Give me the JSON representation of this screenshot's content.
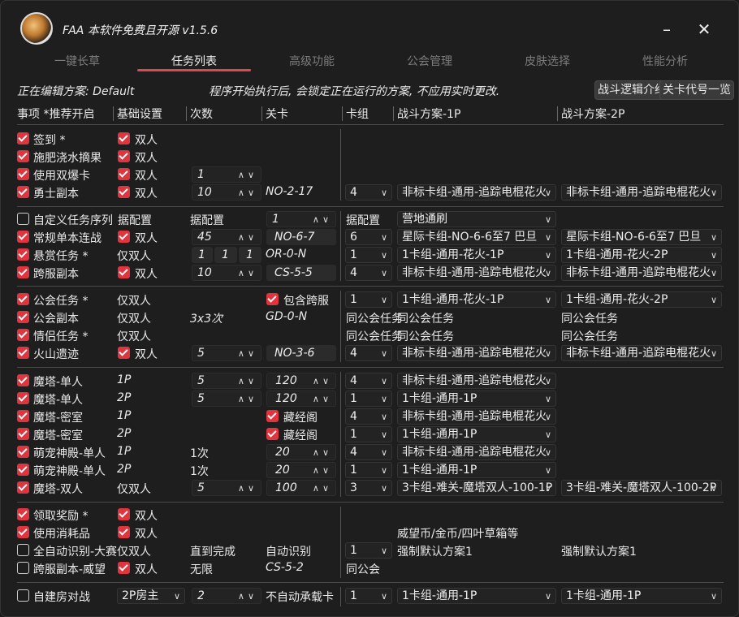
{
  "app": {
    "title": "FAA 本软件免费且开源 v1.5.6",
    "minimize": "–",
    "close": "✕"
  },
  "tabs": [
    {
      "label": "一键长草",
      "active": false
    },
    {
      "label": "任务列表",
      "active": true
    },
    {
      "label": "高级功能",
      "active": false
    },
    {
      "label": "公会管理",
      "active": false
    },
    {
      "label": "皮肤选择",
      "active": false
    },
    {
      "label": "性能分析",
      "active": false
    }
  ],
  "info": {
    "editing": "正在编辑方案: Default",
    "notice": "程序开始执行后, 会锁定正在运行的方案, 不应用实时更改."
  },
  "buttons": {
    "battle_logic": "战斗逻辑介绍",
    "level_codes": "关卡代号一览"
  },
  "headers": {
    "item": "事项 *推荐开启",
    "basic": "基础设置",
    "count": "次数",
    "level": "关卡",
    "deck": "卡组",
    "plan1": "战斗方案-1P",
    "plan2": "战斗方案-2P"
  },
  "colors": {
    "accent": "#e0343f",
    "background": "#1e1e1e"
  },
  "group1": {
    "sign": {
      "label": "签到 *",
      "checked": true,
      "double": "双人",
      "double_checked": true
    },
    "fert": {
      "label": "施肥浇水摘果",
      "checked": true,
      "double": "双人",
      "double_checked": true
    },
    "bomb": {
      "label": "使用双爆卡",
      "checked": true,
      "double": "双人",
      "double_checked": true,
      "count": "1"
    },
    "hero": {
      "label": "勇士副本",
      "checked": true,
      "double": "双人",
      "double_checked": true,
      "count": "10",
      "level": "NO-2-17",
      "deck": "4",
      "plan1": "非标卡组-通用-追踪电棍花火",
      "plan2": "非标卡组-通用-追踪电棍花火"
    }
  },
  "group2": {
    "custom": {
      "label": "自定义任务序列",
      "checked": false,
      "basic": "据配置",
      "count": "据配置",
      "level": "1",
      "deck": "据配置",
      "plan1": "营地通刷"
    },
    "single": {
      "label": "常规单本连战",
      "checked": true,
      "double": "双人",
      "double_checked": true,
      "count": "45",
      "level": "NO-6-7",
      "deck": "6",
      "plan1": "星际卡组-NO-6-6至7 巴旦",
      "plan2": "星际卡组-NO-6-6至7 巴旦"
    },
    "bounty": {
      "label": "悬赏任务 *",
      "checked": true,
      "basic": "仅双人",
      "c1": "1",
      "c2": "1",
      "c3": "1",
      "level": "OR-0-N",
      "deck": "1",
      "plan1": "1卡组-通用-花火-1P",
      "plan2": "1卡组-通用-花火-2P"
    },
    "cross": {
      "label": "跨服副本",
      "checked": true,
      "double": "双人",
      "double_checked": true,
      "count": "10",
      "level": "CS-5-5",
      "deck": "4",
      "plan1": "非标卡组-通用-追踪电棍花火",
      "plan2": "非标卡组-通用-追踪电棍花火"
    }
  },
  "group3": {
    "guild": {
      "label": "公会任务 *",
      "checked": true,
      "basic": "仅双人",
      "include": "包含跨服",
      "include_checked": true,
      "deck": "1",
      "plan1": "1卡组-通用-花火-1P",
      "plan2": "1卡组-通用-花火-2P"
    },
    "guild_dungeon": {
      "label": "公会副本",
      "checked": true,
      "basic": "仅双人",
      "count": "3x3次",
      "level": "GD-0-N",
      "deck": "同公会任务",
      "plan1": "同公会任务",
      "plan2": "同公会任务"
    },
    "couple": {
      "label": "情侣任务 *",
      "checked": true,
      "basic": "仅双人",
      "deck": "同公会任务",
      "plan1": "同公会任务",
      "plan2": "同公会任务"
    },
    "volcano": {
      "label": "火山遗迹",
      "checked": true,
      "double": "双人",
      "double_checked": true,
      "count": "5",
      "level": "NO-3-6",
      "deck": "4",
      "plan1": "非标卡组-通用-追踪电棍花火",
      "plan2": "非标卡组-通用-追踪电棍花火"
    }
  },
  "group4": {
    "tower1": {
      "label": "魔塔-单人",
      "checked": true,
      "basic": "1P",
      "count": "5",
      "level": "120",
      "deck": "4",
      "plan1": "非标卡组-通用-追踪电棍花火"
    },
    "tower2": {
      "label": "魔塔-单人",
      "checked": true,
      "basic": "2P",
      "count": "5",
      "level": "120",
      "deck": "1",
      "plan1": "1卡组-通用-1P"
    },
    "secret1": {
      "label": "魔塔-密室",
      "checked": true,
      "basic": "1P",
      "extra": "藏经阁",
      "extra_checked": true,
      "deck": "4",
      "plan1": "非标卡组-通用-追踪电棍花火"
    },
    "secret2": {
      "label": "魔塔-密室",
      "checked": true,
      "basic": "2P",
      "extra": "藏经阁",
      "extra_checked": true,
      "deck": "1",
      "plan1": "1卡组-通用-1P"
    },
    "pet1": {
      "label": "萌宠神殿-单人",
      "checked": true,
      "basic": "1P",
      "count": "1次",
      "level": "20",
      "deck": "4",
      "plan1": "非标卡组-通用-追踪电棍花火"
    },
    "pet2": {
      "label": "萌宠神殿-单人",
      "checked": true,
      "basic": "2P",
      "count": "1次",
      "level": "20",
      "deck": "1",
      "plan1": "1卡组-通用-1P"
    },
    "tower_double": {
      "label": "魔塔-双人",
      "checked": true,
      "basic": "仅双人",
      "count": "5",
      "level": "100",
      "deck": "3",
      "plan1": "3卡组-难关-魔塔双人-100-1P",
      "plan2": "3卡组-难关-魔塔双人-100-2P"
    }
  },
  "group5": {
    "reward": {
      "label": "领取奖励 *",
      "checked": true,
      "double": "双人",
      "double_checked": true
    },
    "consume": {
      "label": "使用消耗品",
      "checked": true,
      "double": "双人",
      "double_checked": true,
      "plan1": "威望币/金币/四叶草箱等"
    },
    "auto": {
      "label": "全自动识别-大赛",
      "checked": false,
      "basic": "仅双人",
      "count": "直到完成",
      "level": "自动识别",
      "deck": "1",
      "plan1": "强制默认方案1",
      "plan2": "强制默认方案1"
    },
    "cross_prestige": {
      "label": "跨服副本-威望",
      "checked": false,
      "double": "双人",
      "double_checked": true,
      "count": "无限",
      "level": "CS-5-2",
      "deck": "同公会"
    }
  },
  "group6": {
    "room": {
      "label": "自建房对战",
      "checked": false,
      "basic": "2P房主",
      "count": "2",
      "level": "不自动承载卡",
      "deck": "1",
      "plan1": "1卡组-通用-1P",
      "plan2": "1卡组-通用-1P"
    }
  }
}
